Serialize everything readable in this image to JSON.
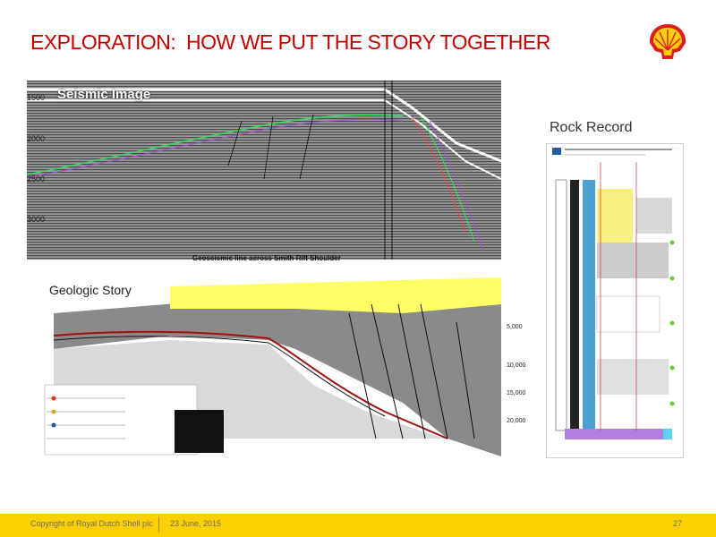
{
  "slide": {
    "title": "EXPLORATION:  HOW WE PUT THE STORY TOGETHER"
  },
  "seismic": {
    "label": "Seismic Image",
    "ticks": [
      "1500",
      "2000",
      "2500",
      "3000"
    ],
    "caption": "Geoseismic line across Smith Rift Shoulder"
  },
  "rock_record": {
    "label": "Rock Record"
  },
  "geologic": {
    "label": "Geologic Story",
    "depths": [
      "5,000",
      "10,000",
      "15,000",
      "20,000"
    ]
  },
  "footer": {
    "copyright": "Copyright of Royal Dutch Shell plc",
    "date": "23 June, 2015",
    "page": "27"
  },
  "colors": {
    "title": "#c00000",
    "footer_bar": "#fcd000",
    "shell_red": "#dd1d21",
    "shell_yellow": "#fbce07"
  },
  "icons": {
    "logo": "shell-pecten-icon"
  }
}
